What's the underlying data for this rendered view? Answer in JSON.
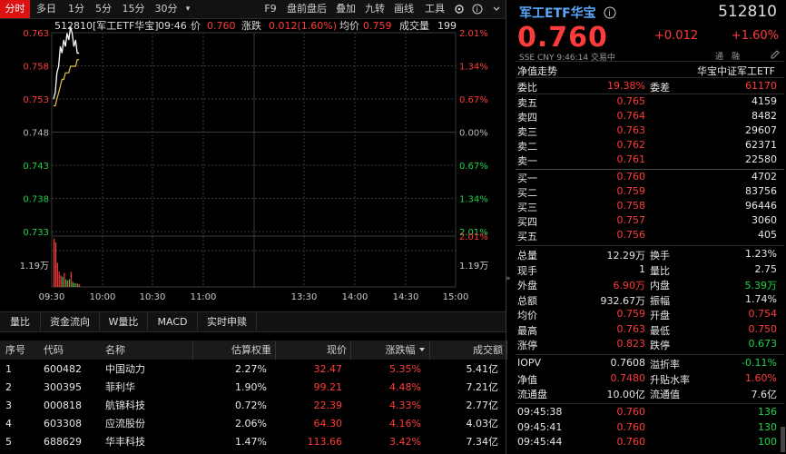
{
  "toolbar": {
    "tabs": [
      "分时",
      "多日",
      "1分",
      "5分",
      "15分",
      "30分"
    ],
    "more": "▾",
    "right": [
      "F9",
      "盘前盘后",
      "叠加",
      "九转",
      "画线",
      "工具"
    ],
    "active_index": 0
  },
  "chart": {
    "header": {
      "code_name": "512810[军工ETF华宝]",
      "time": "09:46",
      "price_label": "价",
      "price": "0.760",
      "chg_label": "涨跌",
      "chg": "0.012(1.60%)",
      "avg_label": "均价",
      "avg": "0.759",
      "vol_label": "成交量",
      "vol": "199"
    },
    "left_ticks": [
      "0.763",
      "0.758",
      "0.753",
      "0.748",
      "0.743",
      "0.738",
      "0.733"
    ],
    "right_ticks": [
      "2.01%",
      "1.34%",
      "0.67%",
      "0.00%",
      "0.67%",
      "1.34%",
      "2.01%"
    ],
    "vol_left_tick": "1.19万",
    "vol_right_ticks": [
      "2.01%",
      "1.19万"
    ],
    "x_labels": [
      "09:30",
      "10:00",
      "10:30",
      "11:00",
      "13:30",
      "14:00",
      "14:30",
      "15:00"
    ],
    "price_line": [
      0.753,
      0.754,
      0.757,
      0.758,
      0.761,
      0.76,
      0.762,
      0.761,
      0.763,
      0.762,
      0.764,
      0.763,
      0.761,
      0.762,
      0.76,
      0.76
    ],
    "avg_line": [
      0.752,
      0.752,
      0.753,
      0.754,
      0.755,
      0.756,
      0.756,
      0.757,
      0.757,
      0.757,
      0.758,
      0.758,
      0.758,
      0.758,
      0.759,
      0.759
    ],
    "volumes": [
      1.9,
      1.75,
      0.95,
      0.6,
      0.45,
      0.4,
      0.55,
      0.3,
      0.25,
      0.3,
      0.6,
      0.2,
      0.15,
      0.15,
      0.12,
      0.1
    ],
    "colors": {
      "price": "#ffffff",
      "avg": "#e8c24a",
      "up": "#ff3b3b",
      "down": "#1fd14a",
      "grid": "#3a3a3a"
    }
  },
  "subtabs": [
    "量比",
    "资金流向",
    "W量比",
    "MACD",
    "实时申赎"
  ],
  "table": {
    "headers": [
      "序号",
      "代码",
      "名称",
      "估算权重",
      "现价",
      "涨跌幅",
      "成交额"
    ],
    "rows": [
      {
        "no": "1",
        "code": "600482",
        "name": "中国动力",
        "weight": "2.27%",
        "price": "32.47",
        "pct": "5.35%",
        "amount": "5.41亿"
      },
      {
        "no": "2",
        "code": "300395",
        "name": "菲利华",
        "weight": "1.90%",
        "price": "99.21",
        "pct": "4.48%",
        "amount": "7.21亿"
      },
      {
        "no": "3",
        "code": "000818",
        "name": "航锦科技",
        "weight": "0.72%",
        "price": "22.39",
        "pct": "4.33%",
        "amount": "2.77亿"
      },
      {
        "no": "4",
        "code": "603308",
        "name": "应流股份",
        "weight": "2.06%",
        "price": "64.30",
        "pct": "4.16%",
        "amount": "4.03亿"
      },
      {
        "no": "5",
        "code": "688629",
        "name": "华丰科技",
        "weight": "1.47%",
        "price": "113.66",
        "pct": "3.42%",
        "amount": "7.34亿"
      }
    ]
  },
  "quote": {
    "title": "军工ETF华宝",
    "code": "512810",
    "price": "0.760",
    "chg": "+0.012",
    "pct": "+1.60%",
    "info": "SSE  CNY  9:46:14  交易中",
    "badges": [
      "通",
      "融"
    ],
    "nav_label": "净值走势",
    "index_name": "华宝中证军工ETF",
    "weibi_label": "委比",
    "weibi": "19.38%",
    "weicha_label": "委差",
    "weicha": "61170",
    "asks": [
      {
        "label": "卖五",
        "price": "0.765",
        "vol": "4159"
      },
      {
        "label": "卖四",
        "price": "0.764",
        "vol": "8482"
      },
      {
        "label": "卖三",
        "price": "0.763",
        "vol": "29607"
      },
      {
        "label": "卖二",
        "price": "0.762",
        "vol": "62371"
      },
      {
        "label": "卖一",
        "price": "0.761",
        "vol": "22580"
      }
    ],
    "bids": [
      {
        "label": "买一",
        "price": "0.760",
        "vol": "4702"
      },
      {
        "label": "买二",
        "price": "0.759",
        "vol": "83756"
      },
      {
        "label": "买三",
        "price": "0.758",
        "vol": "96446"
      },
      {
        "label": "买四",
        "price": "0.757",
        "vol": "3060"
      },
      {
        "label": "买五",
        "price": "0.756",
        "vol": "405"
      }
    ],
    "stats": [
      {
        "l1": "总量",
        "v1": "12.29万",
        "c1": "white",
        "l2": "换手",
        "v2": "1.23%",
        "c2": "white"
      },
      {
        "l1": "现手",
        "v1": "1",
        "c1": "white",
        "l2": "量比",
        "v2": "2.75",
        "c2": "white"
      },
      {
        "l1": "外盘",
        "v1": "6.90万",
        "c1": "red",
        "l2": "内盘",
        "v2": "5.39万",
        "c2": "green"
      },
      {
        "l1": "总额",
        "v1": "932.67万",
        "c1": "white",
        "l2": "振幅",
        "v2": "1.74%",
        "c2": "white"
      },
      {
        "l1": "均价",
        "v1": "0.759",
        "c1": "red",
        "l2": "开盘",
        "v2": "0.754",
        "c2": "red"
      },
      {
        "l1": "最高",
        "v1": "0.763",
        "c1": "red",
        "l2": "最低",
        "v2": "0.750",
        "c2": "red"
      },
      {
        "l1": "涨停",
        "v1": "0.823",
        "c1": "red",
        "l2": "跌停",
        "v2": "0.673",
        "c2": "green"
      }
    ],
    "stats2": [
      {
        "l1": "IOPV",
        "v1": "0.7608",
        "c1": "white",
        "l2": "溢折率",
        "v2": "-0.11%",
        "c2": "green"
      },
      {
        "l1": "净值",
        "v1": "0.7480",
        "c1": "red",
        "l2": "升贴水率",
        "v2": "1.60%",
        "c2": "red"
      },
      {
        "l1": "流通盘",
        "v1": "10.00亿",
        "c1": "white",
        "l2": "流通值",
        "v2": "7.6亿",
        "c2": "white"
      }
    ],
    "ticks": [
      {
        "time": "09:45:38",
        "price": "0.760",
        "vol": "136"
      },
      {
        "time": "09:45:41",
        "price": "0.760",
        "vol": "130"
      },
      {
        "time": "09:45:44",
        "price": "0.760",
        "vol": "100"
      }
    ]
  }
}
